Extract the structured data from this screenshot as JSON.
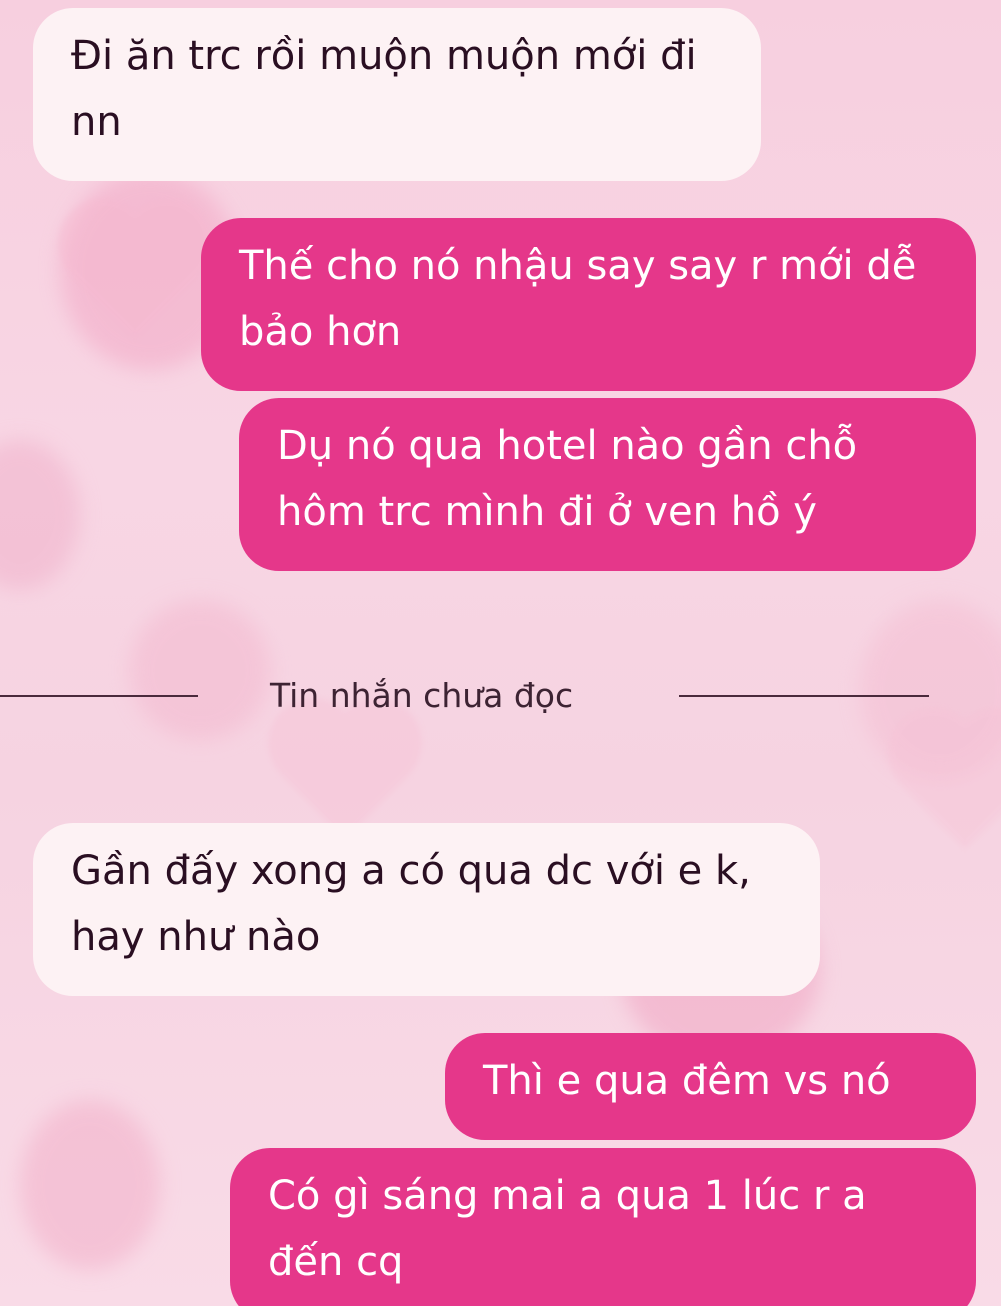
{
  "conversation": {
    "messages": [
      {
        "side": "incoming",
        "text": "Đi ăn trc rồi muộn muộn mới đi nn"
      },
      {
        "side": "outgoing",
        "text": "Thế cho nó nhậu say say r mới dễ bảo hơn"
      },
      {
        "side": "outgoing",
        "text": "Dụ nó qua hotel nào gần chỗ hôm trc mình đi ở ven hồ ý"
      },
      {
        "side": "incoming",
        "text": "Gần đấy xong a có qua dc với e k, hay như nào"
      },
      {
        "side": "outgoing",
        "text": "Thì e qua đêm vs nó"
      },
      {
        "side": "outgoing",
        "text": "Có gì sáng mai a qua 1 lúc r a đến cq"
      }
    ],
    "unread_divider": "Tin nhắn chưa đọc"
  },
  "colors": {
    "incoming_bubble": "#fdf2f4",
    "outgoing_bubble": "#e5378a",
    "background": "#f8d6e4"
  }
}
